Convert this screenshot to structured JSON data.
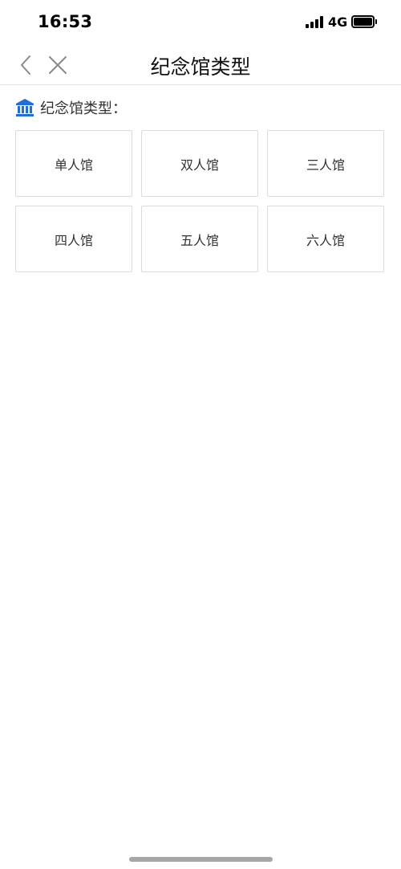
{
  "status_bar": {
    "time": "16:53",
    "network": "4G"
  },
  "nav": {
    "title": "纪念馆类型",
    "back_icon": "chevron-left-icon",
    "close_icon": "close-icon"
  },
  "section": {
    "icon": "museum-icon",
    "icon_color": "#1e6fd9",
    "title": "纪念馆类型："
  },
  "hall_types": [
    "单人馆",
    "双人馆",
    "三人馆",
    "四人馆",
    "五人馆",
    "六人馆"
  ]
}
